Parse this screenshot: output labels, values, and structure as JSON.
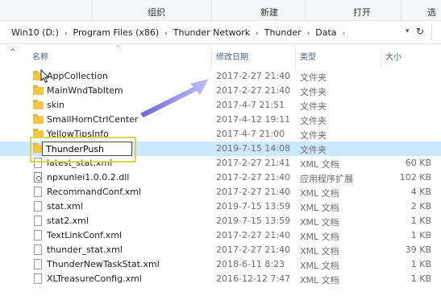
{
  "ribbon": {
    "groups": [
      "组织",
      "新建",
      "打开",
      "选"
    ]
  },
  "address": {
    "crumbs": [
      "Win10 (D:)",
      "Program Files (x86)",
      "Thunder Network",
      "Thunder",
      "Data"
    ],
    "dropdown_icon": "chevron-down-icon",
    "refresh_icon": "refresh-icon"
  },
  "columns": {
    "name": "名称",
    "date": "修改日期",
    "type": "类型",
    "size": "大小"
  },
  "rename": {
    "value": "ThunderPush"
  },
  "colors": {
    "selection": "#cce8ff",
    "highlight": "#d7d848",
    "arrow": "#7a76e0",
    "folder": "#f0c64a"
  },
  "files": [
    {
      "name": "AppCollection",
      "date": "2017-2-27 21:40",
      "type": "文件夹",
      "size": "",
      "icon": "folder-icon"
    },
    {
      "name": "MainWndTabItem",
      "date": "2017-2-27 21:40",
      "type": "文件夹",
      "size": "",
      "icon": "folder-icon"
    },
    {
      "name": "skin",
      "date": "2017-4-7 21:51",
      "type": "文件夹",
      "size": "",
      "icon": "folder-icon"
    },
    {
      "name": "SmallHornCtrlCenter",
      "date": "2017-4-12 19:11",
      "type": "文件夹",
      "size": "",
      "icon": "folder-icon"
    },
    {
      "name": "YellowTipsInfo",
      "date": "2017-4-7 21:00",
      "type": "文件夹",
      "size": "",
      "icon": "folder-icon"
    },
    {
      "name": "",
      "date": "2019-7-15 14:08",
      "type": "文件夹",
      "size": "",
      "icon": "folder-icon"
    },
    {
      "name": "latest_stat.xml",
      "date": "2017-2-27 21:41",
      "type": "XML 文档",
      "size": "60 KB",
      "icon": "file-icon"
    },
    {
      "name": "npxunlei1.0.0.2.dll",
      "date": "2017-2-27 21:40",
      "type": "应用程序扩展",
      "size": "102 KB",
      "icon": "dll-icon"
    },
    {
      "name": "RecommandConf.xml",
      "date": "2017-2-27 21:40",
      "type": "XML 文档",
      "size": "4 KB",
      "icon": "file-icon"
    },
    {
      "name": "stat.xml",
      "date": "2019-7-15 13:59",
      "type": "XML 文档",
      "size": "2 KB",
      "icon": "file-icon"
    },
    {
      "name": "stat2.xml",
      "date": "2019-7-15 13:59",
      "type": "XML 文档",
      "size": "1 KB",
      "icon": "file-icon"
    },
    {
      "name": "TextLinkConf.xml",
      "date": "2017-2-27 21:40",
      "type": "XML 文档",
      "size": "1 KB",
      "icon": "file-icon"
    },
    {
      "name": "thunder_stat.xml",
      "date": "2017-2-27 21:40",
      "type": "XML 文档",
      "size": "39 KB",
      "icon": "file-icon"
    },
    {
      "name": "ThunderNewTaskStat.xml",
      "date": "2018-6-11 8:23",
      "type": "XML 文档",
      "size": "1 KB",
      "icon": "file-icon"
    },
    {
      "name": "XLTreasureConfig.xml",
      "date": "2016-12-12 7:47",
      "type": "XML 文档",
      "size": "1 KB",
      "icon": "file-icon"
    }
  ]
}
